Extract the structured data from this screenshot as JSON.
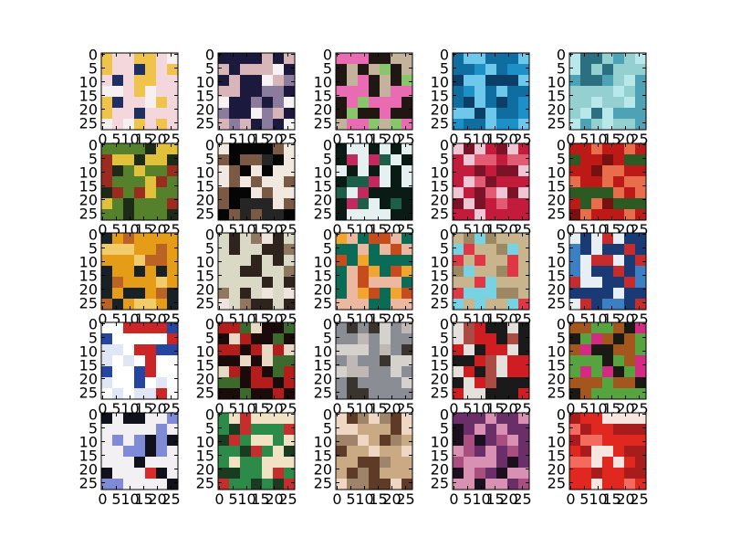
{
  "chart_data": {
    "type": "image-grid",
    "rows": 5,
    "cols": 5,
    "image_size": 28,
    "yticks": [
      "0",
      "5",
      "10",
      "15",
      "20",
      "25"
    ],
    "xticks": [
      "0",
      "5",
      "10",
      "15",
      "20",
      "25"
    ],
    "colors": {
      "axes": "#000000",
      "background": "#ffffff"
    },
    "panels": [
      {
        "palette": [
          "#f4d6dd",
          "#f0c34b",
          "#1e2f63",
          "#f6f0f0"
        ]
      },
      {
        "palette": [
          "#1c1a3c",
          "#f7f3f5",
          "#d8b5b9",
          "#8b7b9c"
        ]
      },
      {
        "palette": [
          "#201612",
          "#e96bb1",
          "#c3b29c",
          "#89c66b"
        ]
      },
      {
        "palette": [
          "#0f6d9f",
          "#1d91c7",
          "#6ec8ec",
          "#0b3f68"
        ]
      },
      {
        "palette": [
          "#94d0cf",
          "#b9e8ea",
          "#4da2b5",
          "#2c6f80"
        ]
      },
      {
        "palette": [
          "#55802c",
          "#e1c13a",
          "#9a2b1e",
          "#1d2a18"
        ]
      },
      {
        "palette": [
          "#050505",
          "#f1e9e0",
          "#252525",
          "#7a5a45"
        ]
      },
      {
        "palette": [
          "#0a1a14",
          "#e4f1f0",
          "#1d5e48",
          "#c22a5f"
        ]
      },
      {
        "palette": [
          "#c31b3c",
          "#efc6d4",
          "#7a1327",
          "#e25b73"
        ]
      },
      {
        "palette": [
          "#bd1a17",
          "#2b5a22",
          "#e76d4b",
          "#761111"
        ]
      },
      {
        "palette": [
          "#e59c17",
          "#172126",
          "#f2cc6a",
          "#ba6325"
        ]
      },
      {
        "palette": [
          "#d9d9c6",
          "#2f231d",
          "#efe5df",
          "#8f7760"
        ]
      },
      {
        "palette": [
          "#0a6b57",
          "#f1a531",
          "#ecb8a0",
          "#c64b1d"
        ]
      },
      {
        "palette": [
          "#c8b58d",
          "#77d3e2",
          "#e03747",
          "#9d8864"
        ]
      },
      {
        "palette": [
          "#1a3a75",
          "#e7eef4",
          "#3d7fc3",
          "#c72b2b"
        ]
      },
      {
        "palette": [
          "#ffffff",
          "#e0e6f5",
          "#cc2525",
          "#2546a0"
        ]
      },
      {
        "palette": [
          "#1a0a0a",
          "#b51d1d",
          "#e7d9c3",
          "#3c6a2c"
        ]
      },
      {
        "palette": [
          "#8b8d94",
          "#d5d1cd",
          "#3a342f",
          "#bfb8b5"
        ]
      },
      {
        "palette": [
          "#cf1d22",
          "#e4e1dd",
          "#1a1a1a",
          "#aa4c44"
        ]
      },
      {
        "palette": [
          "#a3561d",
          "#56a43f",
          "#d52a82",
          "#1a1a14"
        ]
      },
      {
        "palette": [
          "#f2f0f3",
          "#11111b",
          "#7f8bd7",
          "#d82c2c"
        ]
      },
      {
        "palette": [
          "#2c8b49",
          "#f2e2c4",
          "#c62d2d",
          "#1b3b20"
        ]
      },
      {
        "palette": [
          "#c9aa85",
          "#efd7c3",
          "#5d3b26",
          "#a0846a"
        ]
      },
      {
        "palette": [
          "#6a2e69",
          "#d890b3",
          "#1c1020",
          "#a94f80"
        ]
      },
      {
        "palette": [
          "#e02720",
          "#f7e5e0",
          "#a81c1c",
          "#f46a5e"
        ]
      }
    ]
  }
}
